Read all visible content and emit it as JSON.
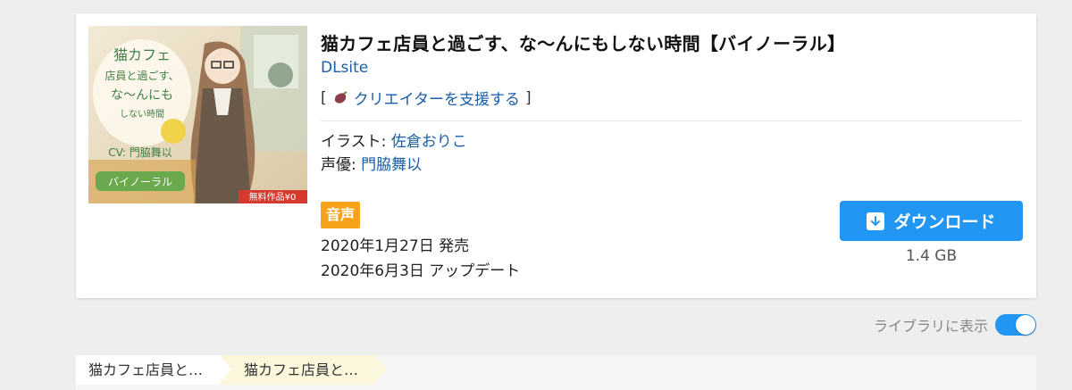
{
  "work": {
    "title": "猫カフェ店員と過ごす、な〜んにもしない時間【バイノーラル】",
    "maker": "DLsite",
    "support_open": "[",
    "support_label": "クリエイターを支援する",
    "support_close": "]",
    "credits": [
      {
        "label": "イラスト: ",
        "value": "佐倉おりこ"
      },
      {
        "label": "声優: ",
        "value": "門脇舞以"
      }
    ],
    "category_badge": "音声",
    "release_date": "2020年1月27日 発売",
    "update_date": "2020年6月3日 アップデート",
    "download_label": "ダウンロード",
    "file_size": "1.4 GB",
    "thumbnail": {
      "title_lines": [
        "猫カフェ",
        "店員と過ごす、",
        "な〜んにも",
        "しない時間"
      ],
      "cv_text": "CV: 門脇舞以",
      "binaural_label": "バイノーラル",
      "free_label": "無料作品¥0"
    }
  },
  "library": {
    "label": "ライブラリに表示",
    "toggle_on": true
  },
  "breadcrumbs": [
    {
      "label": "猫カフェ店員と…"
    },
    {
      "label": "猫カフェ店員と…"
    }
  ],
  "colors": {
    "accent": "#2196f3",
    "link": "#1a5fa8",
    "badge": "#f6a21b"
  },
  "icons": {
    "support": "sweet-potato-icon",
    "download": "download-arrow-icon"
  }
}
